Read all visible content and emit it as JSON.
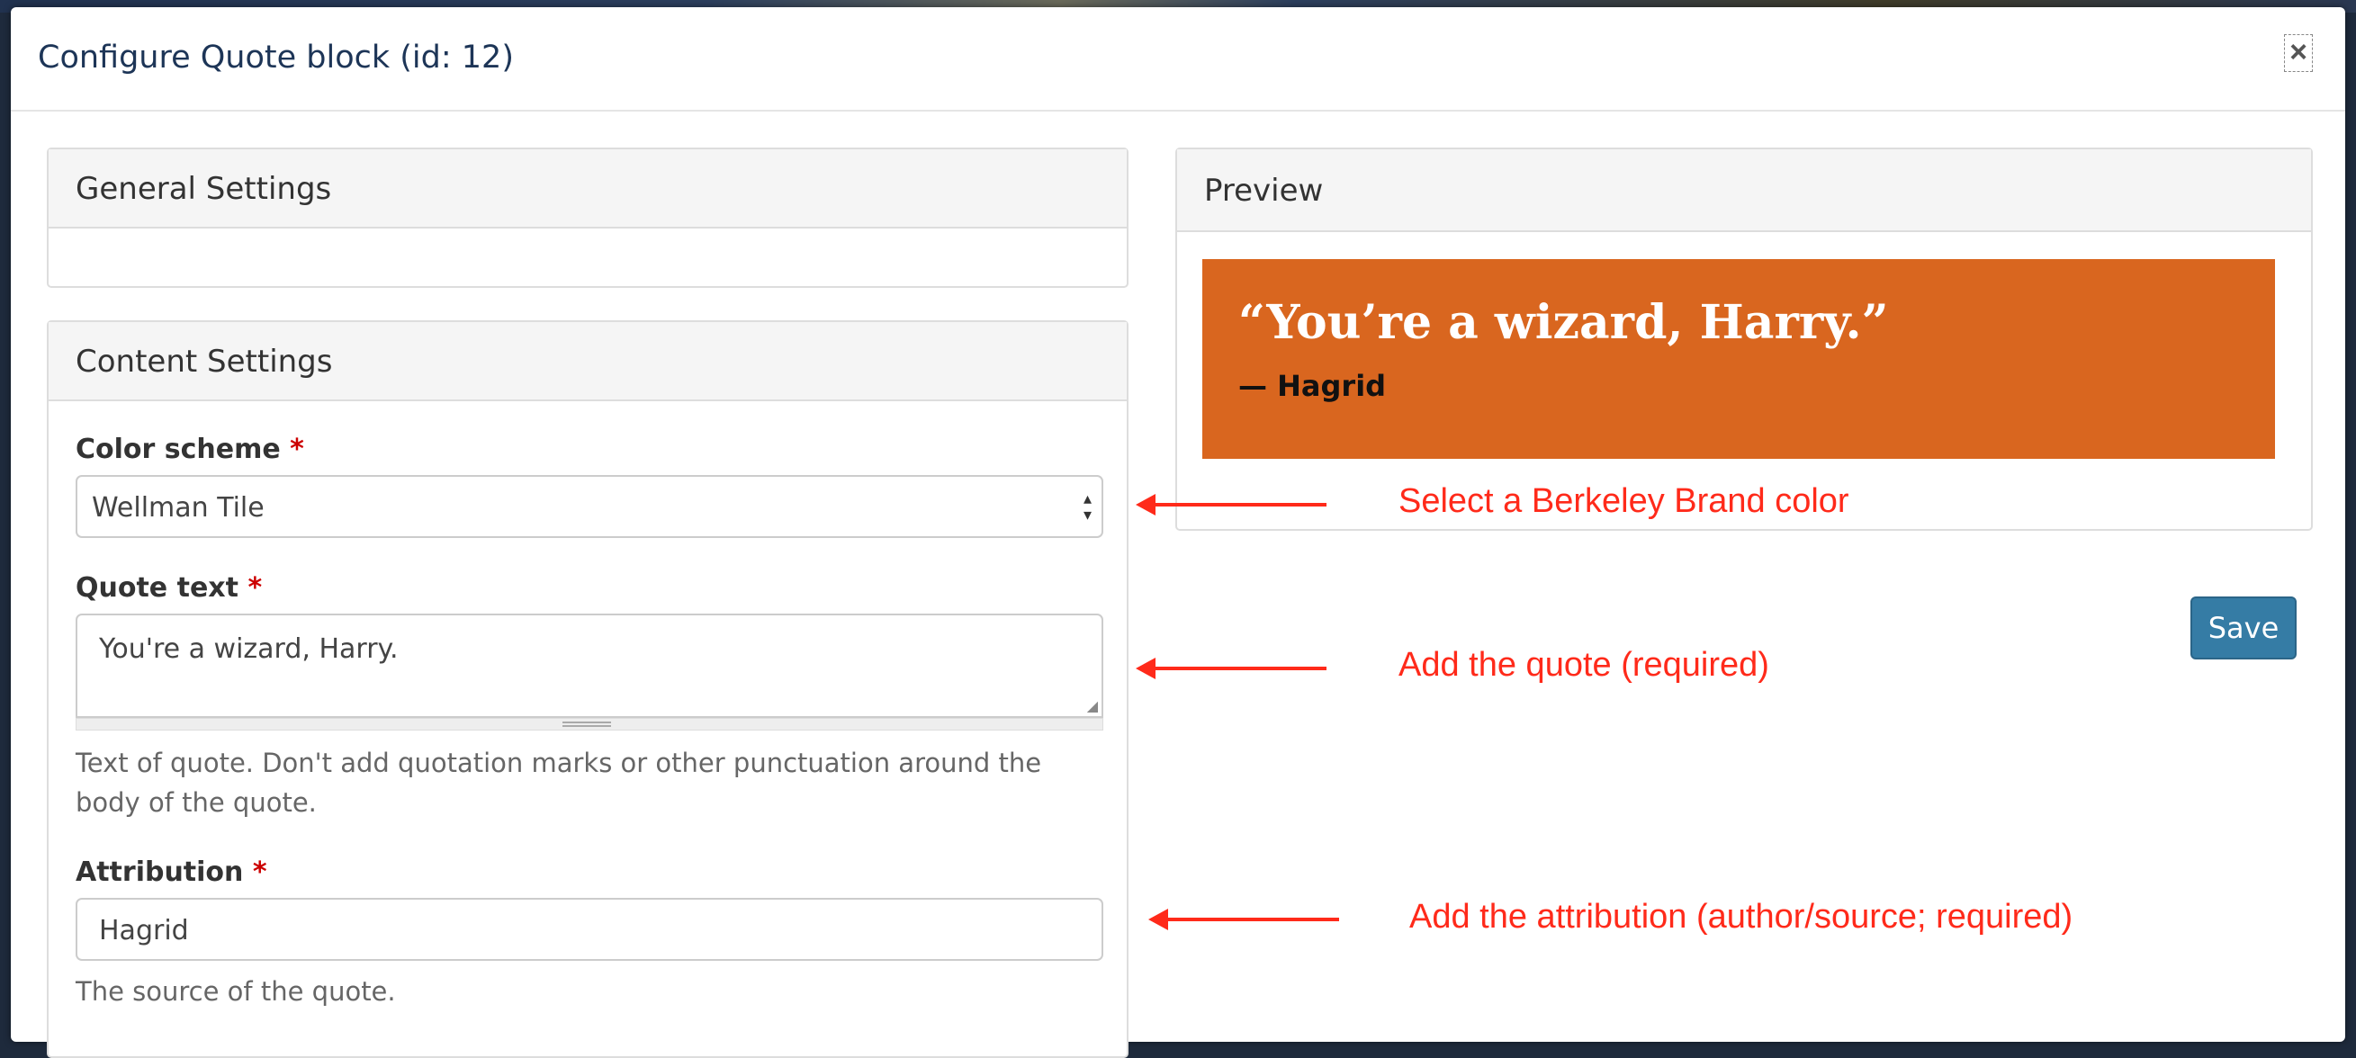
{
  "modal": {
    "title": "Configure Quote block (id: 12)",
    "close_label": "×"
  },
  "general_settings": {
    "heading": "General Settings"
  },
  "content_settings": {
    "heading": "Content Settings",
    "color_scheme": {
      "label": "Color scheme",
      "required_mark": "*",
      "value": "Wellman Tile",
      "arrow_symbol": "▴▾"
    },
    "quote_text": {
      "label": "Quote text",
      "required_mark": "*",
      "value": "You're a wizard, Harry.",
      "help": "Text of quote. Don't add quotation marks or other punctuation around the body of the quote."
    },
    "attribution": {
      "label": "Attribution",
      "required_mark": "*",
      "value": "Hagrid",
      "help": "The source of the quote."
    }
  },
  "preview": {
    "heading": "Preview",
    "quote": "“You’re a wizard, Harry.”",
    "attribution": "— Hagrid",
    "background_color": "#d9661f"
  },
  "save_label": "Save",
  "annotations": {
    "color": "Select a Berkeley Brand color",
    "quote": "Add the quote (required)",
    "attribution": "Add the attribution (author/source; required)"
  },
  "colors": {
    "accent": "#357ca5",
    "annotation": "#ff2a1a",
    "title": "#1d3557"
  }
}
